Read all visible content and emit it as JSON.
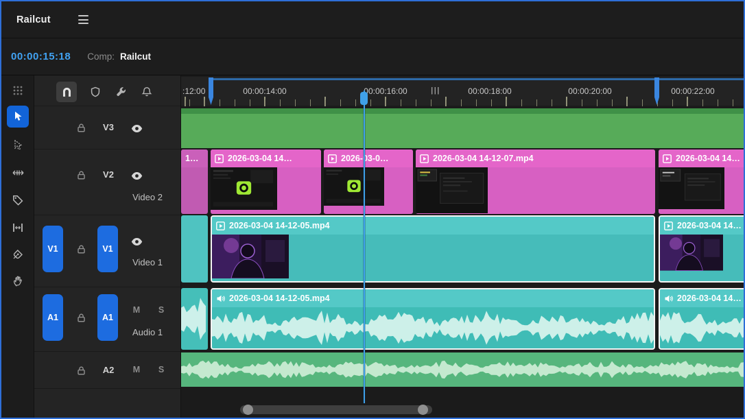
{
  "window": {
    "title": "Railcut"
  },
  "header": {
    "timecode": "00:00:15:18",
    "comp_label": "Comp:",
    "comp_name": "Railcut"
  },
  "ruler": {
    "labels": [
      ":12:00",
      "00:00:14:00",
      "00:00:16:00",
      "|||",
      "00:00:18:00",
      "00:00:20:00",
      "00:00:22:00"
    ]
  },
  "tracks": {
    "v3": {
      "name": "V3"
    },
    "v2": {
      "name": "V2",
      "label": "Video 2"
    },
    "v1": {
      "name": "V1",
      "label": "Video 1",
      "source": "V1",
      "target": "V1"
    },
    "a1": {
      "name": "A1",
      "label": "Audio 1",
      "source": "A1",
      "target": "A1",
      "mute": "M",
      "solo": "S"
    },
    "a2": {
      "name": "A2",
      "mute": "M",
      "solo": "S"
    }
  },
  "clips": {
    "v2": [
      {
        "label": "1…"
      },
      {
        "label": "2026-03-04 14…"
      },
      {
        "label": "2026-03-0…"
      },
      {
        "label": "2026-03-04 14-12-07.mp4"
      },
      {
        "label": "2026-03-04 14…"
      }
    ],
    "v1": [
      {
        "label": "2026-03-04 14-12-05.mp4",
        "selected": true
      },
      {
        "label": "2026-03-04 14…",
        "selected": true
      }
    ],
    "a1": [
      {
        "label": "2026-03-04 14-12-05.mp4",
        "selected": true
      },
      {
        "label": "2026-03-04 14…",
        "selected": true
      }
    ]
  },
  "icons": {
    "topbar": [
      "menu"
    ],
    "tools": [
      "panel-grip",
      "selection",
      "track-select",
      "slide",
      "label-tag",
      "ripple-edit",
      "pen",
      "hand"
    ],
    "track_controls": [
      "snap-magnet",
      "shield-marker",
      "wrench",
      "bell",
      "lock",
      "eye",
      "mute",
      "solo"
    ],
    "clip_badges": [
      "play-box",
      "speaker"
    ]
  },
  "colors": {
    "accent_blue": "#1d6ce0",
    "playhead": "#3fa0e8",
    "timecode": "#41a2f2",
    "video_clip_teal": "#46bcba",
    "overlay_clip_pink": "#d760c2",
    "v3_clip_green": "#57ab59",
    "a2_clip_green": "#56b67d",
    "window_border": "#2e6fd8"
  }
}
